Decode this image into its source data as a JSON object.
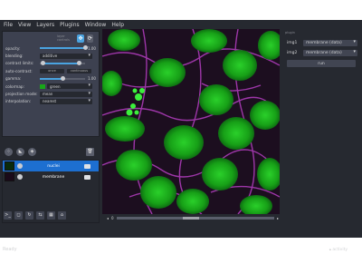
{
  "menu": [
    "File",
    "View",
    "Layers",
    "Plugins",
    "Window",
    "Help"
  ],
  "layer_controls": {
    "header_label": "layer controls",
    "rows": [
      {
        "label": "opacity:",
        "value": "1.00",
        "fraction": 1.0
      },
      {
        "label": "blending:",
        "select": "additive"
      },
      {
        "label": "contrast limits:",
        "low": 0.05,
        "high": 0.85
      },
      {
        "label": "auto-contrast:",
        "buttons": [
          "once",
          "continuous"
        ]
      },
      {
        "label": "gamma:",
        "value": "1.00",
        "fraction": 0.5
      },
      {
        "label": "colormap:",
        "select": "green",
        "color": "#18a818"
      },
      {
        "label": "projection mode:",
        "select": "mean"
      },
      {
        "label": "interpolation:",
        "select": "nearest"
      }
    ]
  },
  "layers": [
    {
      "name": "nuclei",
      "active": true
    },
    {
      "name": "membrane",
      "active": false
    }
  ],
  "right_panel": {
    "header_label": "plugin",
    "img1_label": "img1",
    "img1_value": "membrane (data)",
    "img2_label": "img2",
    "img2_value": "membrane (data)",
    "run_label": "run"
  },
  "dims_slider": {
    "label": "0",
    "position": 0.47
  },
  "status": {
    "left": "Ready",
    "right": "activity"
  },
  "colors": {
    "nuclei": "#1fc01f",
    "membrane": "#c040c8",
    "accent": "#4aa3e0",
    "selected_layer": "#1d6fd0"
  }
}
